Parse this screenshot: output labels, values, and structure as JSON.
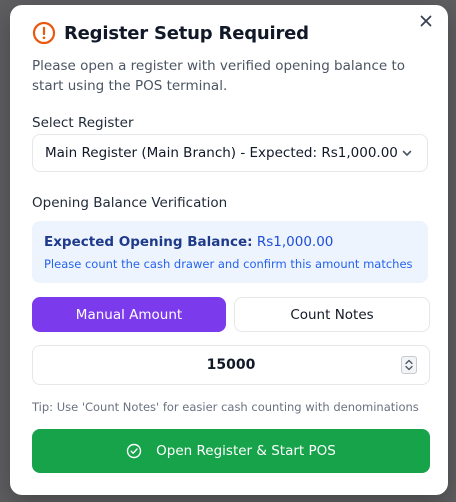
{
  "colors": {
    "accent": "#7c3aed",
    "success": "#16a34a",
    "warning": "#ea580c",
    "info_bg": "#eef4fe"
  },
  "modal": {
    "close_icon": "close-icon",
    "title": "Register Setup Required",
    "title_icon": "warning-circle-icon",
    "description": "Please open a register with verified opening balance to start using the POS terminal.",
    "select_register": {
      "label": "Select Register",
      "value": "Main Register (Main Branch) - Expected: Rs1,000.00",
      "icon": "chevron-down-icon"
    },
    "verification": {
      "label": "Opening Balance Verification",
      "expected_label": "Expected Opening Balance:",
      "expected_value": "Rs1,000.00",
      "note": "Please count the cash drawer and confirm this amount matches"
    },
    "tabs": {
      "manual": "Manual Amount",
      "count": "Count Notes"
    },
    "amount": {
      "value": "15000"
    },
    "tip": "Tip: Use 'Count Notes' for easier cash counting with denominations",
    "submit": {
      "label": "Open Register & Start POS",
      "icon": "check-circle-icon"
    }
  }
}
